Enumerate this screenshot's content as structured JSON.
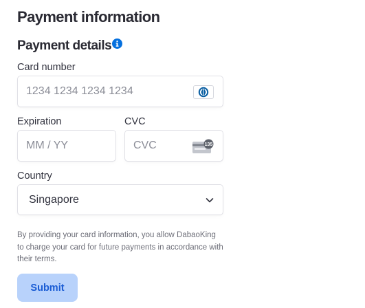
{
  "header": {
    "title": "Payment information"
  },
  "payment_details": {
    "title": "Payment details",
    "info_icon": "info-circle-icon"
  },
  "card_number": {
    "label": "Card number",
    "placeholder": "1234 1234 1234 1234",
    "value": "",
    "brand_icon": "diners-club-icon"
  },
  "expiration": {
    "label": "Expiration",
    "placeholder": "MM / YY",
    "value": ""
  },
  "cvc": {
    "label": "CVC",
    "placeholder": "CVC",
    "value": "",
    "icon": "cvc-card-icon",
    "icon_digits": "135"
  },
  "country": {
    "label": "Country",
    "selected": "Singapore",
    "icon": "chevron-down-icon"
  },
  "disclaimer": "By providing your card information, you allow DabaoKing to charge your card for future payments in accordance with their terms.",
  "submit": {
    "label": "Submit"
  },
  "colors": {
    "accent": "#0570de",
    "button_bg": "#b8d2fb",
    "button_text": "#1a5cd4",
    "text": "#30313d",
    "muted_text": "#6d6e78",
    "border": "#e0e0e6"
  }
}
